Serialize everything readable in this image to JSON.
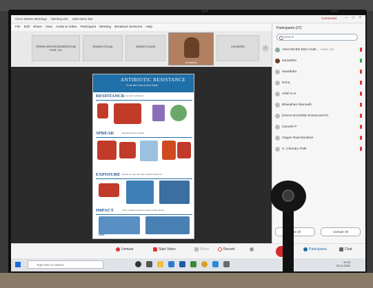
{
  "window": {
    "tabs": [
      "Cisco Webex Meetings",
      "Meeting Info",
      "Hide Menu Bar"
    ],
    "status": "Connected",
    "controls": [
      "–",
      "□",
      "×"
    ]
  },
  "menubar": [
    "File",
    "Edit",
    "Share",
    "View",
    "Audio & Video",
    "Participant",
    "Meeting",
    "Breakout Sessions",
    "Help"
  ],
  "video_strip": {
    "tiles": [
      {
        "label": "WWW.ADVANCEDEDUHUB",
        "sub": "Host, me"
      },
      {
        "label": "Student Group"
      },
      {
        "label": "Student Guest"
      },
      {
        "label": "somastha"
      }
    ],
    "camera_label": "somastha",
    "next_label": "›"
  },
  "poster": {
    "title": "ANTIBIOTIC RESISTANCE",
    "subtitle": "From the Farm to the Table",
    "sections": [
      {
        "title": "RESISTANCE",
        "desc": "Germs resist antibiotics"
      },
      {
        "title": "SPREAD",
        "desc": "Resistant germs spread"
      },
      {
        "title": "EXPOSURE",
        "desc": "People can get sick with resistant infections"
      },
      {
        "title": "IMPACT",
        "desc": "Some resistant infections cause severe illness"
      }
    ],
    "logo": "CDC"
  },
  "toolbar": {
    "mute": "Unmute",
    "video": "Start Video",
    "share": "Share",
    "record": "Record",
    "participants": "Participants",
    "chat": "Chat"
  },
  "participants": {
    "header": "Participants (27)",
    "search_placeholder": "Search",
    "list": [
      {
        "name": "ADVANCED EDU HUB...",
        "sub": "Host, me",
        "mic": "muted"
      },
      {
        "name": "somastha",
        "mic": "on"
      },
      {
        "name": "swasthika",
        "mic": "muted"
      },
      {
        "name": "lecha",
        "mic": "muted"
      },
      {
        "name": "Ashil G.H",
        "mic": "muted"
      },
      {
        "name": "Bharathan Ramnath",
        "mic": "muted"
      },
      {
        "name": "DIVAS MYSORE RANGANATH",
        "mic": "muted"
      },
      {
        "name": "Ganesh P",
        "mic": "muted"
      },
      {
        "name": "Gagan Ravichandran",
        "mic": "muted"
      },
      {
        "name": "H. Chandru Patil",
        "mic": "muted"
      }
    ],
    "mute_all": "Mute All",
    "unmute_all": "Unmute All"
  },
  "taskbar": {
    "search_placeholder": "Type here to search",
    "time": "10:33",
    "date": "03-11-2020"
  },
  "colors": {
    "accent": "#1f6fa8",
    "end": "#d42a2a",
    "muted": "#d33333"
  }
}
